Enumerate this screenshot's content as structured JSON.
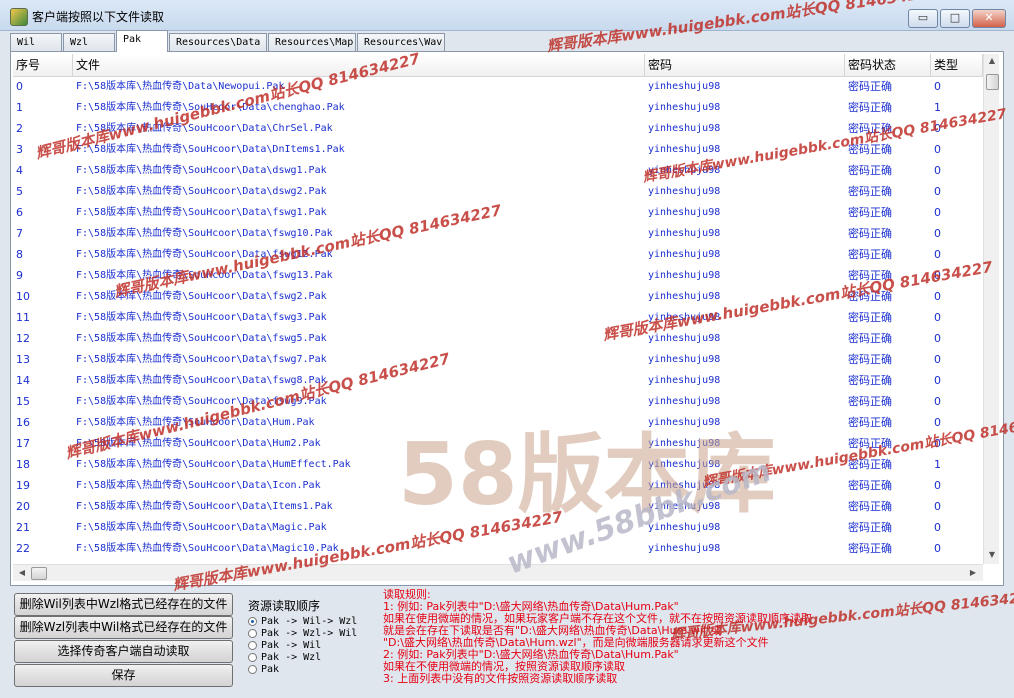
{
  "window": {
    "title": "客户端按照以下文件读取",
    "minimize": "▭",
    "maximize": "□",
    "close": "✕"
  },
  "tabs": [
    {
      "label": "Wil"
    },
    {
      "label": "Wzl"
    },
    {
      "label": "Pak"
    },
    {
      "label": "Resources\\Data"
    },
    {
      "label": "Resources\\Map"
    },
    {
      "label": "Resources\\Wav"
    }
  ],
  "table": {
    "columns": [
      "序号",
      "文件",
      "密码",
      "密码状态",
      "类型"
    ],
    "rows": [
      {
        "no": "0",
        "file": "F:\\58版本库\\热血传奇\\Data\\Newopui.Pak",
        "pwd": "yinheshuju98",
        "status": "密码正确",
        "type": "0"
      },
      {
        "no": "1",
        "file": "F:\\58版本库\\热血传奇\\SouHcoor\\Data\\chenghao.Pak",
        "pwd": "yinheshuju98",
        "status": "密码正确",
        "type": "1"
      },
      {
        "no": "2",
        "file": "F:\\58版本库\\热血传奇\\SouHcoor\\Data\\ChrSel.Pak",
        "pwd": "yinheshuju98",
        "status": "密码正确",
        "type": "0"
      },
      {
        "no": "3",
        "file": "F:\\58版本库\\热血传奇\\SouHcoor\\Data\\DnItems1.Pak",
        "pwd": "yinheshuju98",
        "status": "密码正确",
        "type": "0"
      },
      {
        "no": "4",
        "file": "F:\\58版本库\\热血传奇\\SouHcoor\\Data\\dswg1.Pak",
        "pwd": "yinheshuju98",
        "status": "密码正确",
        "type": "0"
      },
      {
        "no": "5",
        "file": "F:\\58版本库\\热血传奇\\SouHcoor\\Data\\dswg2.Pak",
        "pwd": "yinheshuju98",
        "status": "密码正确",
        "type": "0"
      },
      {
        "no": "6",
        "file": "F:\\58版本库\\热血传奇\\SouHcoor\\Data\\fswg1.Pak",
        "pwd": "yinheshuju98",
        "status": "密码正确",
        "type": "0"
      },
      {
        "no": "7",
        "file": "F:\\58版本库\\热血传奇\\SouHcoor\\Data\\fswg10.Pak",
        "pwd": "yinheshuju98",
        "status": "密码正确",
        "type": "0"
      },
      {
        "no": "8",
        "file": "F:\\58版本库\\热血传奇\\SouHcoor\\Data\\fswg12.Pak",
        "pwd": "yinheshuju98",
        "status": "密码正确",
        "type": "0"
      },
      {
        "no": "9",
        "file": "F:\\58版本库\\热血传奇\\SouHcoor\\Data\\fswg13.Pak",
        "pwd": "yinheshuju98",
        "status": "密码正确",
        "type": "0"
      },
      {
        "no": "10",
        "file": "F:\\58版本库\\热血传奇\\SouHcoor\\Data\\fswg2.Pak",
        "pwd": "yinheshuju98",
        "status": "密码正确",
        "type": "0"
      },
      {
        "no": "11",
        "file": "F:\\58版本库\\热血传奇\\SouHcoor\\Data\\fswg3.Pak",
        "pwd": "yinheshuju98",
        "status": "密码正确",
        "type": "0"
      },
      {
        "no": "12",
        "file": "F:\\58版本库\\热血传奇\\SouHcoor\\Data\\fswg5.Pak",
        "pwd": "yinheshuju98",
        "status": "密码正确",
        "type": "0"
      },
      {
        "no": "13",
        "file": "F:\\58版本库\\热血传奇\\SouHcoor\\Data\\fswg7.Pak",
        "pwd": "yinheshuju98",
        "status": "密码正确",
        "type": "0"
      },
      {
        "no": "14",
        "file": "F:\\58版本库\\热血传奇\\SouHcoor\\Data\\fswg8.Pak",
        "pwd": "yinheshuju98",
        "status": "密码正确",
        "type": "0"
      },
      {
        "no": "15",
        "file": "F:\\58版本库\\热血传奇\\SouHcoor\\Data\\fswg9.Pak",
        "pwd": "yinheshuju98",
        "status": "密码正确",
        "type": "0"
      },
      {
        "no": "16",
        "file": "F:\\58版本库\\热血传奇\\SouHcoor\\Data\\Hum.Pak",
        "pwd": "yinheshuju98",
        "status": "密码正确",
        "type": "0"
      },
      {
        "no": "17",
        "file": "F:\\58版本库\\热血传奇\\SouHcoor\\Data\\Hum2.Pak",
        "pwd": "yinheshuju98",
        "status": "密码正确",
        "type": "0"
      },
      {
        "no": "18",
        "file": "F:\\58版本库\\热血传奇\\SouHcoor\\Data\\HumEffect.Pak",
        "pwd": "yinheshuju98",
        "status": "密码正确",
        "type": "1"
      },
      {
        "no": "19",
        "file": "F:\\58版本库\\热血传奇\\SouHcoor\\Data\\Icon.Pak",
        "pwd": "yinheshuju98",
        "status": "密码正确",
        "type": "0"
      },
      {
        "no": "20",
        "file": "F:\\58版本库\\热血传奇\\SouHcoor\\Data\\Items1.Pak",
        "pwd": "yinheshuju98",
        "status": "密码正确",
        "type": "0"
      },
      {
        "no": "21",
        "file": "F:\\58版本库\\热血传奇\\SouHcoor\\Data\\Magic.Pak",
        "pwd": "yinheshuju98",
        "status": "密码正确",
        "type": "0"
      },
      {
        "no": "22",
        "file": "F:\\58版本库\\热血传奇\\SouHcoor\\Data\\Magic10.Pak",
        "pwd": "yinheshuju98",
        "status": "密码正确",
        "type": "0"
      }
    ]
  },
  "buttons": {
    "delete_wil": "删除Wil列表中Wzl格式已经存在的文件",
    "delete_wzl": "删除Wzl列表中Wil格式已经存在的文件",
    "auto_read": "选择传奇客户端自动读取",
    "save": "保存"
  },
  "resource_order": {
    "title": "资源读取顺序",
    "options": [
      {
        "label": "Pak -> Wil-> Wzl",
        "selected": true
      },
      {
        "label": "Pak -> Wzl-> Wil",
        "selected": false
      },
      {
        "label": "Pak -> Wil",
        "selected": false
      },
      {
        "label": "Pak -> Wzl",
        "selected": false
      },
      {
        "label": "Pak",
        "selected": false
      }
    ]
  },
  "rules": [
    "读取规则:",
    "1: 例如: Pak列表中\"D:\\盛大网络\\热血传奇\\Data\\Hum.Pak\"",
    "    如果在使用微端的情况，如果玩家客户端不存在这个文件，就不在按照资源读取顺序读取",
    "    就是会在存在下读取是否有\"D:\\盛大网络\\热血传奇\\Data\\Hum.wil\"或",
    "    \"D:\\盛大网络\\热血传奇\\Data\\Hum.wzl\"，而是向微端服务器请求更新这个文件",
    "2: 例如: Pak列表中\"D:\\盛大网络\\热血传奇\\Data\\Hum.Pak\"",
    "    如果在不使用微端的情况，按照资源读取顺序读取",
    "3: 上面列表中没有的文件按照资源读取顺序读取"
  ],
  "watermarks": [
    "辉哥版本库www.huigebbk.com站长QQ 814634227",
    "58版本库",
    "www.58bbk.com"
  ],
  "colors": {
    "link_blue": "#1b2fd0",
    "rule_red": "#e60012",
    "watermark_red": "#c0322b"
  }
}
